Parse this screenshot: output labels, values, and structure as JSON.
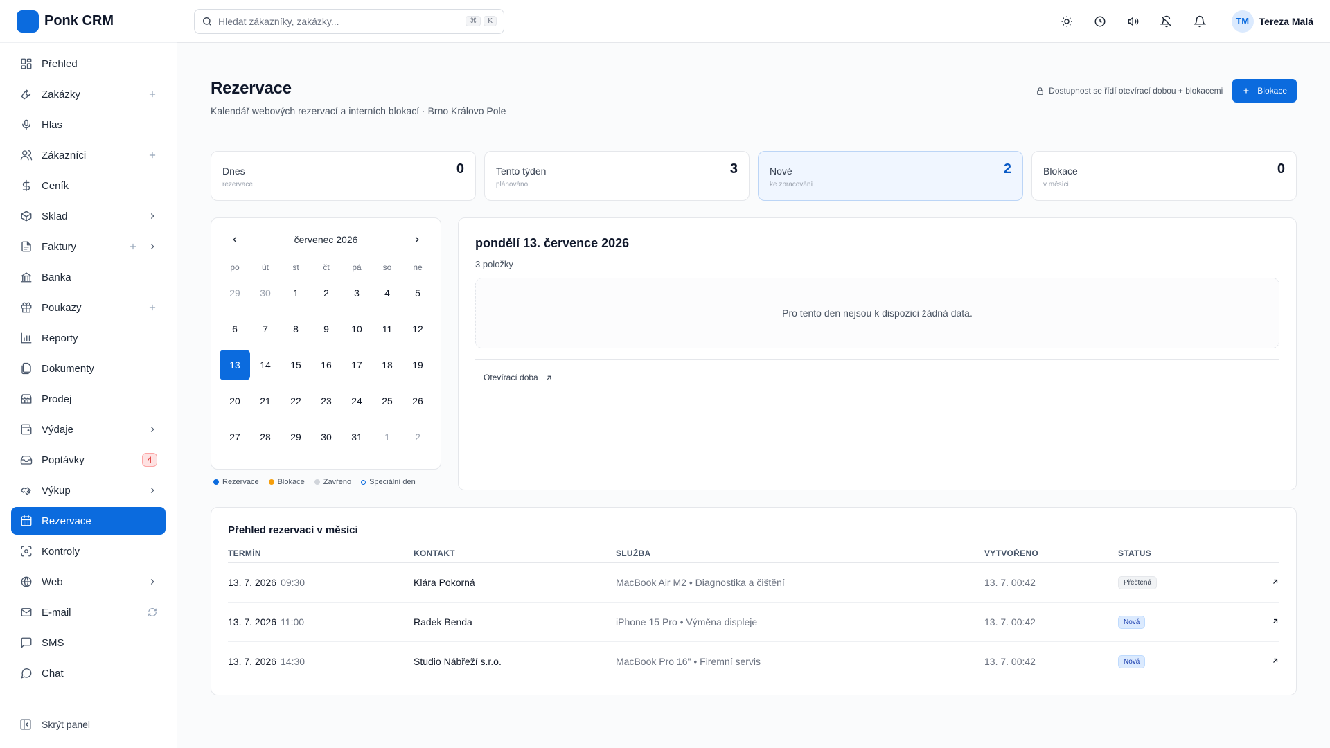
{
  "brand": {
    "name": "Ponk CRM",
    "color": "#0b6bde"
  },
  "sidebar": {
    "items": [
      {
        "label": "Přehled",
        "icon": "dashboard-icon"
      },
      {
        "label": "Zakázky",
        "icon": "wrench-icon",
        "plus": true
      },
      {
        "label": "Hlas",
        "icon": "microphone-icon"
      },
      {
        "label": "Zákazníci",
        "icon": "users-icon",
        "plus": true
      },
      {
        "label": "Ceník",
        "icon": "dollar-icon"
      },
      {
        "label": "Sklad",
        "icon": "package-icon",
        "chevron": true
      },
      {
        "label": "Faktury",
        "icon": "invoice-icon",
        "plus": true,
        "chevron": true
      },
      {
        "label": "Banka",
        "icon": "bank-icon"
      },
      {
        "label": "Poukazy",
        "icon": "gift-icon",
        "plus": true
      },
      {
        "label": "Reporty",
        "icon": "chart-icon"
      },
      {
        "label": "Dokumenty",
        "icon": "documents-icon"
      },
      {
        "label": "Prodej",
        "icon": "store-icon"
      },
      {
        "label": "Výdaje",
        "icon": "wallet-icon",
        "chevron": true
      },
      {
        "label": "Poptávky",
        "icon": "inbox-icon",
        "badge": "4"
      },
      {
        "label": "Výkup",
        "icon": "handshake-icon",
        "chevron": true
      },
      {
        "label": "Rezervace",
        "icon": "calendar-icon",
        "active": true
      },
      {
        "label": "Kontroly",
        "icon": "scan-icon"
      },
      {
        "label": "Web",
        "icon": "globe-icon",
        "chevron": true
      },
      {
        "label": "E-mail",
        "icon": "mail-icon",
        "sync": true
      },
      {
        "label": "SMS",
        "icon": "message-icon"
      },
      {
        "label": "Chat",
        "icon": "chat-icon"
      }
    ],
    "footer_label": "Skrýt panel"
  },
  "topbar": {
    "search_placeholder": "Hledat zákazníky, zakázky...",
    "kbd1": "⌘",
    "kbd2": "K",
    "user_initials": "TM",
    "user_name": "Tereza Malá"
  },
  "page": {
    "title": "Rezervace",
    "subtitle": "Kalendář webových rezervací a interních blokací · Brno Královo Pole",
    "availability_note": "Dostupnost se řídí otevírací dobou + blokacemi",
    "primary_button": "Blokace"
  },
  "stats": [
    {
      "label": "Dnes",
      "hint": "rezervace",
      "value": "0"
    },
    {
      "label": "Tento týden",
      "hint": "plánováno",
      "value": "3"
    },
    {
      "label": "Nové",
      "hint": "ke zpracování",
      "value": "2",
      "highlight": true
    },
    {
      "label": "Blokace",
      "hint": "v měsíci",
      "value": "0"
    }
  ],
  "calendar": {
    "month": "červenec 2026",
    "weekdays": [
      "po",
      "út",
      "st",
      "čt",
      "pá",
      "so",
      "ne"
    ],
    "days": [
      {
        "d": "29",
        "muted": true
      },
      {
        "d": "30",
        "muted": true
      },
      {
        "d": "1"
      },
      {
        "d": "2"
      },
      {
        "d": "3"
      },
      {
        "d": "4"
      },
      {
        "d": "5"
      },
      {
        "d": "6"
      },
      {
        "d": "7"
      },
      {
        "d": "8"
      },
      {
        "d": "9"
      },
      {
        "d": "10"
      },
      {
        "d": "11"
      },
      {
        "d": "12"
      },
      {
        "d": "13",
        "selected": true
      },
      {
        "d": "14"
      },
      {
        "d": "15"
      },
      {
        "d": "16"
      },
      {
        "d": "17"
      },
      {
        "d": "18"
      },
      {
        "d": "19"
      },
      {
        "d": "20"
      },
      {
        "d": "21"
      },
      {
        "d": "22"
      },
      {
        "d": "23"
      },
      {
        "d": "24"
      },
      {
        "d": "25"
      },
      {
        "d": "26"
      },
      {
        "d": "27"
      },
      {
        "d": "28"
      },
      {
        "d": "29"
      },
      {
        "d": "30"
      },
      {
        "d": "31"
      },
      {
        "d": "1",
        "muted": true
      },
      {
        "d": "2",
        "muted": true
      }
    ],
    "legend": [
      {
        "label": "Rezervace",
        "color": "#0b6bde",
        "style": "filled"
      },
      {
        "label": "Blokace",
        "color": "#f59e0b",
        "style": "filled"
      },
      {
        "label": "Zavřeno",
        "color": "#d1d5db",
        "style": "filled"
      },
      {
        "label": "Speciální den",
        "color": "#0b6bde",
        "style": "outline"
      }
    ]
  },
  "day_panel": {
    "title": "pondělí 13. července 2026",
    "count": "3 položky",
    "empty_text": "Pro tento den nejsou k dispozici žádná data.",
    "link_label": "Otevírací doba"
  },
  "table": {
    "title": "Přehled rezervací v měsíci",
    "columns": [
      "TERMÍN",
      "KONTAKT",
      "SLUŽBA",
      "VYTVOŘENO",
      "STATUS"
    ],
    "rows": [
      {
        "date": "13. 7. 2026",
        "time": "09:30",
        "contact": "Klára Pokorná",
        "service": "MacBook Air M2 • Diagnostika a čištění",
        "created": "13. 7. 00:42",
        "status": "Přečtená",
        "status_type": "read"
      },
      {
        "date": "13. 7. 2026",
        "time": "11:00",
        "contact": "Radek Benda",
        "service": "iPhone 15 Pro • Výměna displeje",
        "created": "13. 7. 00:42",
        "status": "Nová",
        "status_type": "new"
      },
      {
        "date": "13. 7. 2026",
        "time": "14:30",
        "contact": "Studio Nábřeží s.r.o.",
        "service": "MacBook Pro 16\" • Firemní servis",
        "created": "13. 7. 00:42",
        "status": "Nová",
        "status_type": "new"
      }
    ]
  }
}
